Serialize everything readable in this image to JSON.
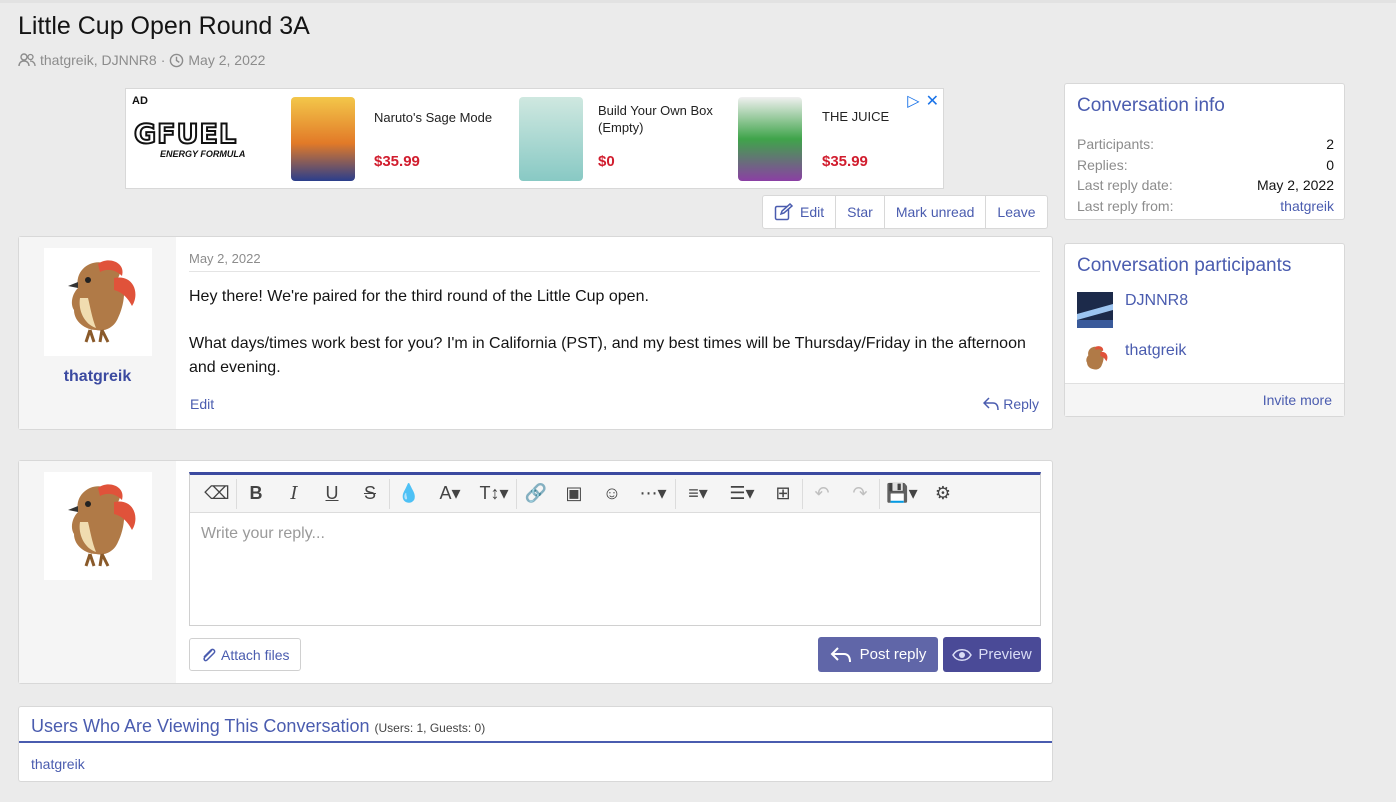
{
  "page": {
    "title": "Little Cup Open Round 3A",
    "participants_line": "thatgreik, DJNNR8",
    "date": "May 2, 2022"
  },
  "ad": {
    "label": "AD",
    "brand": "GFUEL",
    "brand_sub": "ENERGY FORMULA",
    "products": [
      {
        "name": "Naruto's Sage Mode",
        "price": "$35.99",
        "color": "#e27a28"
      },
      {
        "name": "Build Your Own Box (Empty)",
        "price": "$0",
        "color": "#88c9c4"
      },
      {
        "name": "THE JUICE",
        "price": "$35.99",
        "color": "#3fa44a"
      }
    ]
  },
  "actions": {
    "edit": "Edit",
    "star": "Star",
    "mark_unread": "Mark unread",
    "leave": "Leave"
  },
  "message": {
    "author": "thatgreik",
    "date": "May 2, 2022",
    "paragraphs": [
      "Hey there! We're paired for the third round of the Little Cup open.",
      "What days/times work best for you? I'm in California (PST), and my best times will be Thursday/Friday in the afternoon and evening."
    ],
    "edit": "Edit",
    "reply": "Reply"
  },
  "editor": {
    "placeholder": "Write your reply...",
    "attach": "Attach files",
    "post": "Post reply",
    "preview": "Preview"
  },
  "viewers": {
    "title": "Users Who Are Viewing This Conversation",
    "count": "(Users: 1, Guests: 0)",
    "list": "thatgreik"
  },
  "info": {
    "title": "Conversation info",
    "rows": [
      {
        "k": "Participants:",
        "v": "2"
      },
      {
        "k": "Replies:",
        "v": "0"
      },
      {
        "k": "Last reply date:",
        "v": "May 2, 2022"
      },
      {
        "k": "Last reply from:",
        "v": "thatgreik"
      }
    ]
  },
  "participants": {
    "title": "Conversation participants",
    "list": [
      "DJNNR8",
      "thatgreik"
    ],
    "invite": "Invite more"
  },
  "colors": {
    "accent": "#4a5caf",
    "post_btn": "#6066a8",
    "preview_btn": "#4a4a97",
    "price": "#d11d2e"
  }
}
